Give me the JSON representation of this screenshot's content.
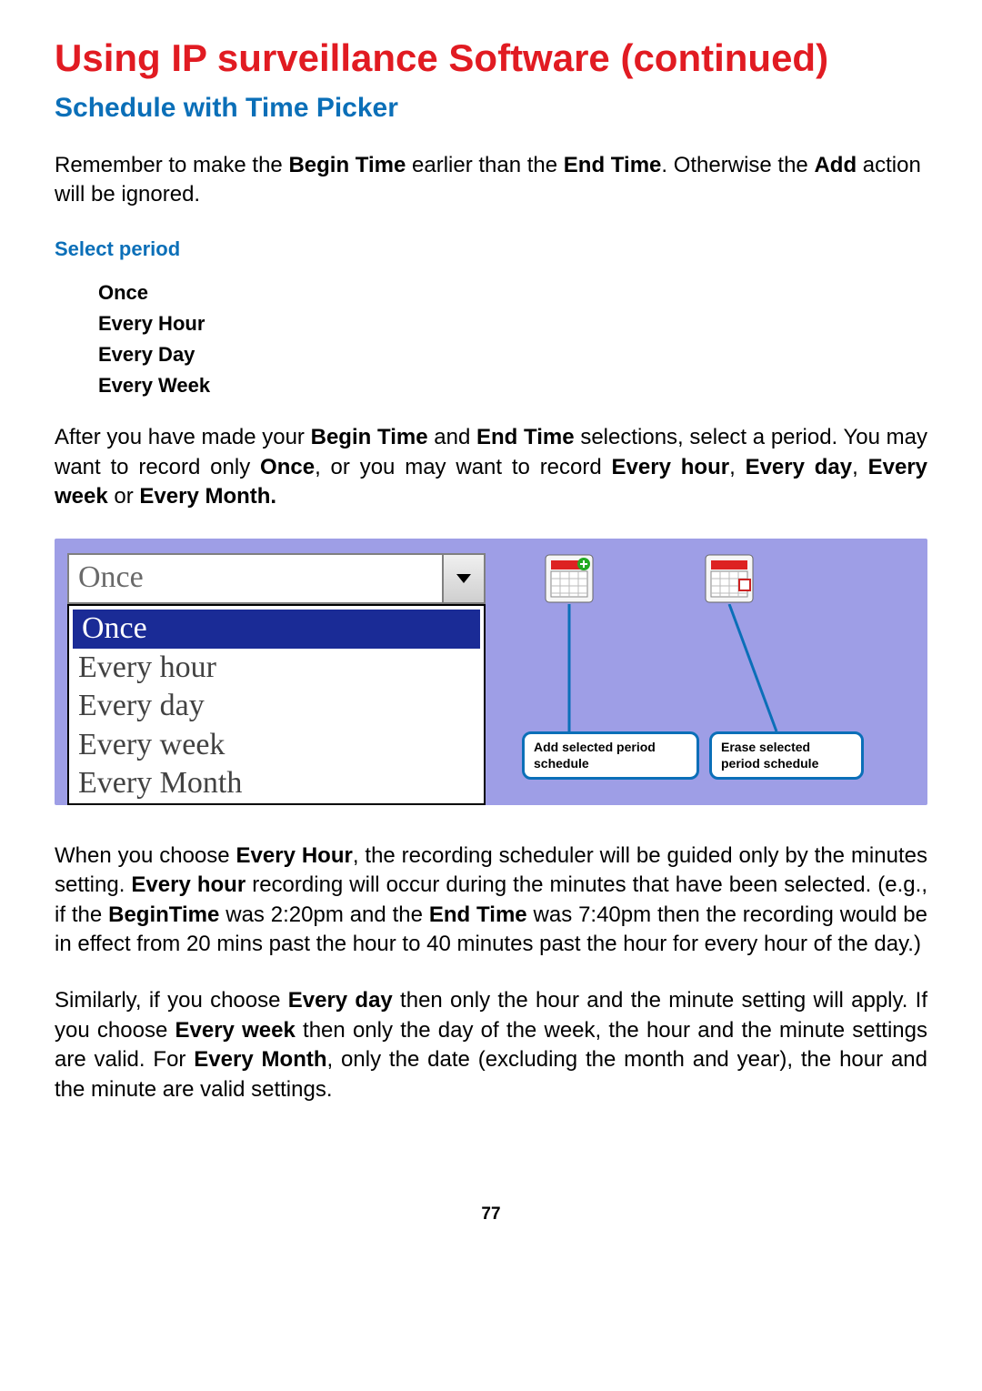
{
  "title": "Using IP surveillance Software (continued)",
  "subtitle": "Schedule with Time Picker",
  "intro": {
    "t1": "Remember to make the ",
    "b1": "Begin Time",
    "t2": " earlier than the ",
    "b2": "End Time",
    "t3": ". Otherwise the ",
    "b3": "Add",
    "t4": " action will be ignored."
  },
  "select_period_label": "Select period",
  "period_options": {
    "o1": "Once",
    "o2": "Every Hour",
    "o3": "Every Day",
    "o4": "Every Week"
  },
  "para2": {
    "t1": "After you have made your ",
    "b1": "Begin Time",
    "t2": " and ",
    "b2": "End Time",
    "t3": " selections, select a period. You may want to record only ",
    "b3": "Once",
    "t4": ", or you may want to record ",
    "b4": "Every hour",
    "t5": ", ",
    "b5": "Every day",
    "t6": ", ",
    "b6": "Every week",
    "t7": " or ",
    "b7": "Every Month."
  },
  "dropdown": {
    "selected": "Once",
    "options": [
      "Once",
      "Every hour",
      "Every day",
      "Every week",
      "Every Month"
    ]
  },
  "callouts": {
    "add": "Add selected period schedule",
    "erase": "Erase selected period schedule"
  },
  "para3": {
    "t1": "When you choose ",
    "b1": "Every Hour",
    "t2": ", the recording scheduler will  be guided only by the minutes setting. ",
    "b2": "Every hour",
    "t3": " recording will occur during the minutes that have been selected. (e.g., if the ",
    "b3": "BeginTime",
    "t4": " was 2:20pm and the ",
    "b4": "End Time",
    "t5": " was 7:40pm then the recording would be in effect from 20 mins past the hour to 40 minutes past the hour for every hour of the day.)"
  },
  "para4": {
    "t1": "Similarly, if you choose ",
    "b1": "Every day",
    "t2": " then only the hour and the minute setting will apply. If you choose ",
    "b2": "Every week",
    "t3": " then only the day of the week, the hour and the minute settings are valid. For ",
    "b3": "Every Month",
    "t4": ", only the date (excluding the month and year), the hour and the minute are valid settings."
  },
  "page_number": "77"
}
